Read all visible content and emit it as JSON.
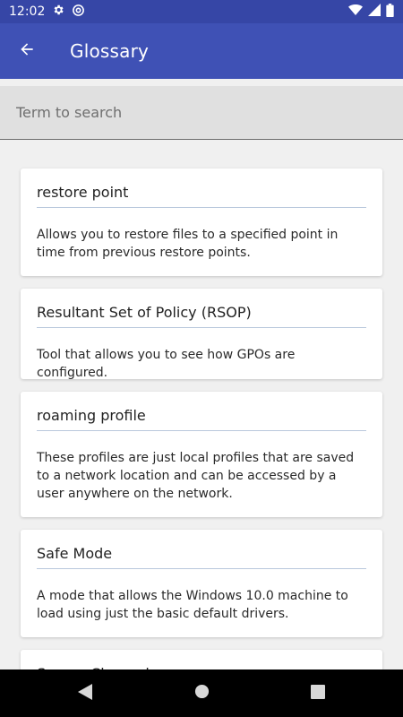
{
  "status_bar": {
    "time": "12:02",
    "icons": [
      "gear-icon",
      "at-sign-icon",
      "wifi-icon",
      "signal-icon",
      "battery-icon"
    ]
  },
  "app_bar": {
    "title": "Glossary",
    "back_icon": "arrow-left-icon",
    "color": "#3f51b5"
  },
  "search": {
    "placeholder": "Term to search",
    "value": ""
  },
  "glossary": [
    {
      "term": "restore point",
      "definition": "Allows you to restore files to a specified point in time from previous restore points."
    },
    {
      "term": "Resultant Set of Policy (RSOP)",
      "definition": "Tool that allows you to see how GPOs are configured."
    },
    {
      "term": "roaming profile",
      "definition": "These profiles are just local profiles that are saved to a network location and can be accessed by a user anywhere on the network."
    },
    {
      "term": "Safe Mode",
      "definition": "A mode that allows the Windows 10.0 machine to load using just the basic default drivers."
    },
    {
      "term": "Secure Channel",
      "definition": ""
    }
  ],
  "nav_bar": {
    "buttons": [
      "back-triangle-icon",
      "home-circle-icon",
      "recents-square-icon"
    ]
  }
}
